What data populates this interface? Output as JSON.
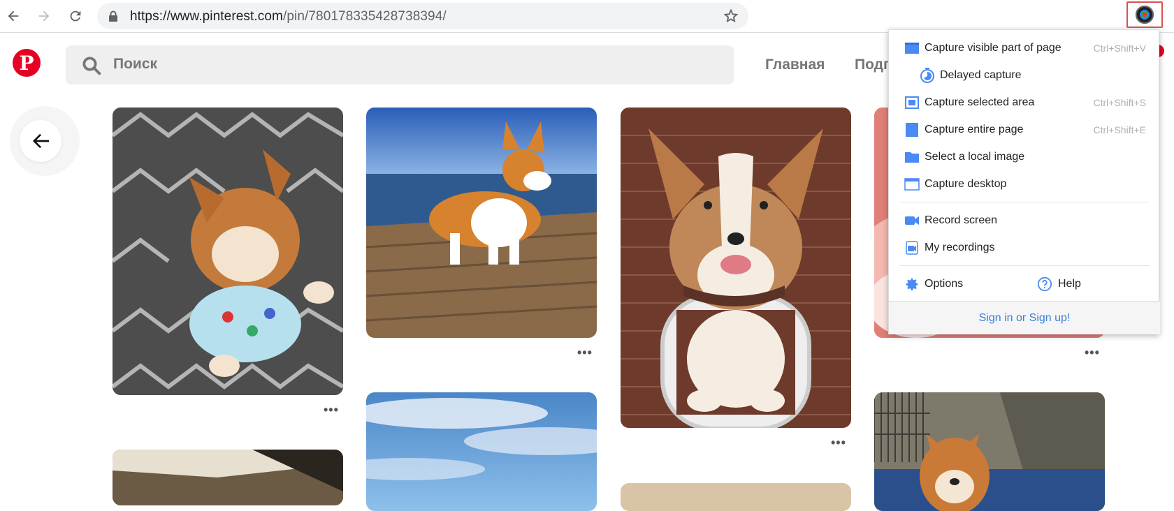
{
  "browser": {
    "url_host": "https://www.pinterest.com",
    "url_path": "/pin/780178335428738394/",
    "icons": [
      "back-arrow-icon",
      "forward-arrow-icon",
      "reload-icon",
      "lock-icon",
      "bookmark-star-icon",
      "screenshot-extension-icon"
    ]
  },
  "pinterest": {
    "logo_letter": "P",
    "search_placeholder": "Поиск",
    "nav": [
      "Главная",
      "Подп"
    ],
    "brand_color": "#e60023"
  },
  "pins": {
    "more_label": "•••"
  },
  "popup": {
    "items": [
      {
        "label": "Capture visible part of page",
        "shortcut": "Ctrl+Shift+V",
        "icon": "visible-page-icon"
      },
      {
        "label": "Delayed capture",
        "shortcut": "",
        "icon": "timer-icon"
      },
      {
        "label": "Capture selected area",
        "shortcut": "Ctrl+Shift+S",
        "icon": "selected-area-icon"
      },
      {
        "label": "Capture entire page",
        "shortcut": "Ctrl+Shift+E",
        "icon": "entire-page-icon"
      },
      {
        "label": "Select a local image",
        "shortcut": "",
        "icon": "folder-icon"
      },
      {
        "label": "Capture desktop",
        "shortcut": "",
        "icon": "desktop-icon"
      },
      {
        "label": "Record screen",
        "shortcut": "",
        "icon": "video-camera-icon"
      },
      {
        "label": "My recordings",
        "shortcut": "",
        "icon": "recordings-icon"
      }
    ],
    "options_label": "Options",
    "help_label": "Help",
    "footer_link": "Sign in or Sign up!",
    "accent_color": "#4a8af4"
  }
}
